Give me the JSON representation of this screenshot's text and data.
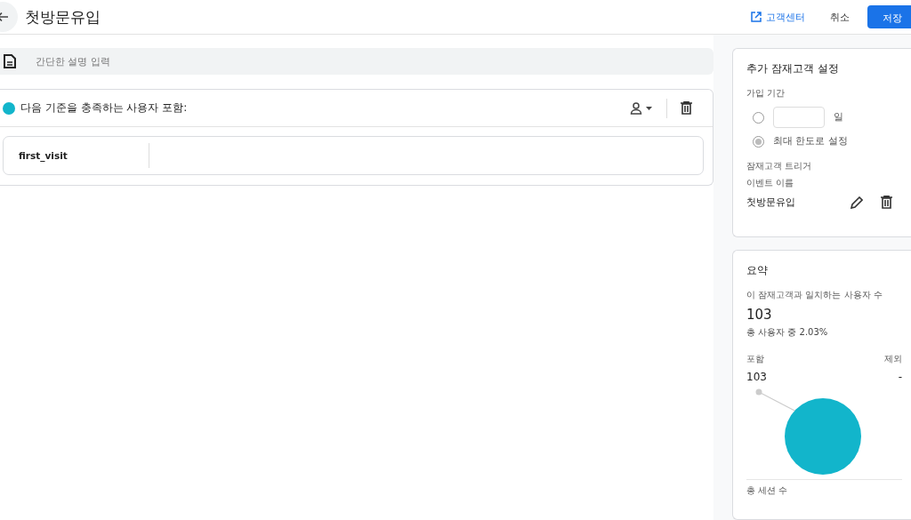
{
  "header": {
    "title": "첫방문유입",
    "help_link": "고객센터",
    "cancel": "취소",
    "save": "저장"
  },
  "description": {
    "placeholder": "간단한 설명 입력"
  },
  "condition": {
    "label": "다음 기준을 충족하는 사용자 포함:",
    "color": "#12b5cb",
    "event": "first_visit"
  },
  "settings": {
    "title": "추가 잠재고객 설정",
    "duration_label": "가입 기간",
    "options": [
      {
        "kind": "days",
        "unit": "일",
        "selected": false
      },
      {
        "kind": "max",
        "label": "최대 한도로 설정",
        "selected": true
      }
    ],
    "trigger_label": "잠재고객 트리거",
    "event_name_label": "이벤트 이름",
    "event_name": "첫방문유입"
  },
  "summary": {
    "title": "요약",
    "users_label": "이 잠재고객과 일치하는 사용자 수",
    "users": "103",
    "share": "총 사용자 중 2.03%",
    "include_label": "포함",
    "exclude_label": "제외",
    "include_value": "103",
    "exclude_value": "-",
    "next_label": "총 세션 수"
  }
}
